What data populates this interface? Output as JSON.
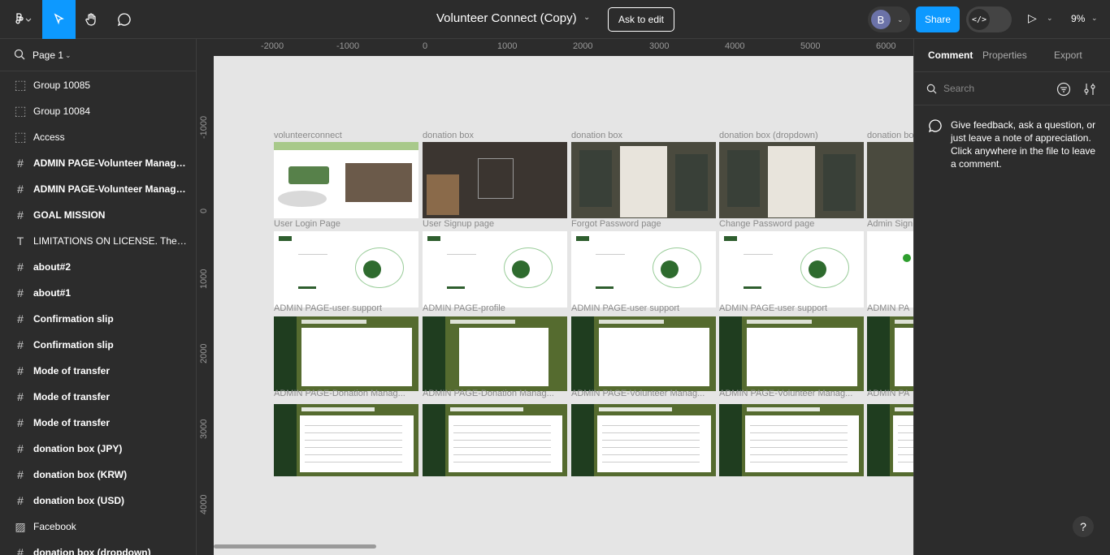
{
  "toolbar": {
    "file_title": "Volunteer Connect (Copy)",
    "ask_to_edit": "Ask to edit",
    "avatar_initial": "B",
    "share": "Share",
    "dev_mode_icon": "</>",
    "zoom": "9%"
  },
  "left_panel": {
    "page_name": "Page 1",
    "layers": [
      {
        "icon": "group-icon",
        "label": "Group 10085",
        "bold": false
      },
      {
        "icon": "group-icon",
        "label": "Group 10084",
        "bold": false
      },
      {
        "icon": "group-icon",
        "label": "Access",
        "bold": false
      },
      {
        "icon": "frame-icon",
        "label": "ADMIN PAGE-Volunteer Manage...",
        "bold": true
      },
      {
        "icon": "frame-icon",
        "label": "ADMIN PAGE-Volunteer Manage...",
        "bold": true
      },
      {
        "icon": "frame-icon",
        "label": "GOAL MISSION",
        "bold": true
      },
      {
        "icon": "text-icon",
        "label": "LIMITATIONS ON LICENSE. The li...",
        "bold": false
      },
      {
        "icon": "frame-icon",
        "label": "about#2",
        "bold": true
      },
      {
        "icon": "frame-icon",
        "label": "about#1",
        "bold": true
      },
      {
        "icon": "frame-icon",
        "label": "Confirmation slip",
        "bold": true
      },
      {
        "icon": "frame-icon",
        "label": "Confirmation slip",
        "bold": true
      },
      {
        "icon": "frame-icon",
        "label": "Mode of transfer",
        "bold": true
      },
      {
        "icon": "frame-icon",
        "label": "Mode of transfer",
        "bold": true
      },
      {
        "icon": "frame-icon",
        "label": "Mode of transfer",
        "bold": true
      },
      {
        "icon": "frame-icon",
        "label": "donation box (JPY)",
        "bold": true
      },
      {
        "icon": "frame-icon",
        "label": "donation box (KRW)",
        "bold": true
      },
      {
        "icon": "frame-icon",
        "label": "donation box (USD)",
        "bold": true
      },
      {
        "icon": "image-icon",
        "label": "Facebook",
        "bold": false
      },
      {
        "icon": "frame-icon",
        "label": "donation box (dropdown)",
        "bold": true
      }
    ]
  },
  "canvas": {
    "ruler_x": [
      "-2000",
      "-1000",
      "0",
      "1000",
      "2000",
      "3000",
      "4000",
      "5000",
      "6000"
    ],
    "ruler_y": [
      "-1000",
      "0",
      "1000",
      "2000",
      "3000",
      "4000"
    ],
    "frame_labels": [
      "volunteerconnect",
      "donation box",
      "donation box",
      "donation box (dropdown)",
      "donation bo",
      "User Login Page",
      "User Signup page",
      "Forgot Password page",
      "Change Password page",
      "Admin Sign",
      "ADMIN PAGE-user support",
      "ADMIN PAGE-profile",
      "ADMIN PAGE-user support",
      "ADMIN PAGE-user support",
      "ADMIN PA",
      "ADMIN PAGE-Donation Manag...",
      "ADMIN PAGE-Donation Manag...",
      "ADMIN PAGE-Volunteer Manag...",
      "ADMIN PAGE-Volunteer Manag...",
      "ADMIN PA"
    ]
  },
  "right_panel": {
    "tabs": [
      "Comment",
      "Properties",
      "Export"
    ],
    "search_placeholder": "Search",
    "message": "Give feedback, ask a question, or just leave a note of appreciation. Click anywhere in the file to leave a comment."
  },
  "help": "?",
  "colors": {
    "accent": "#0d99ff",
    "admin_green": "#556b2f",
    "dark_green": "#1f3d1f"
  }
}
